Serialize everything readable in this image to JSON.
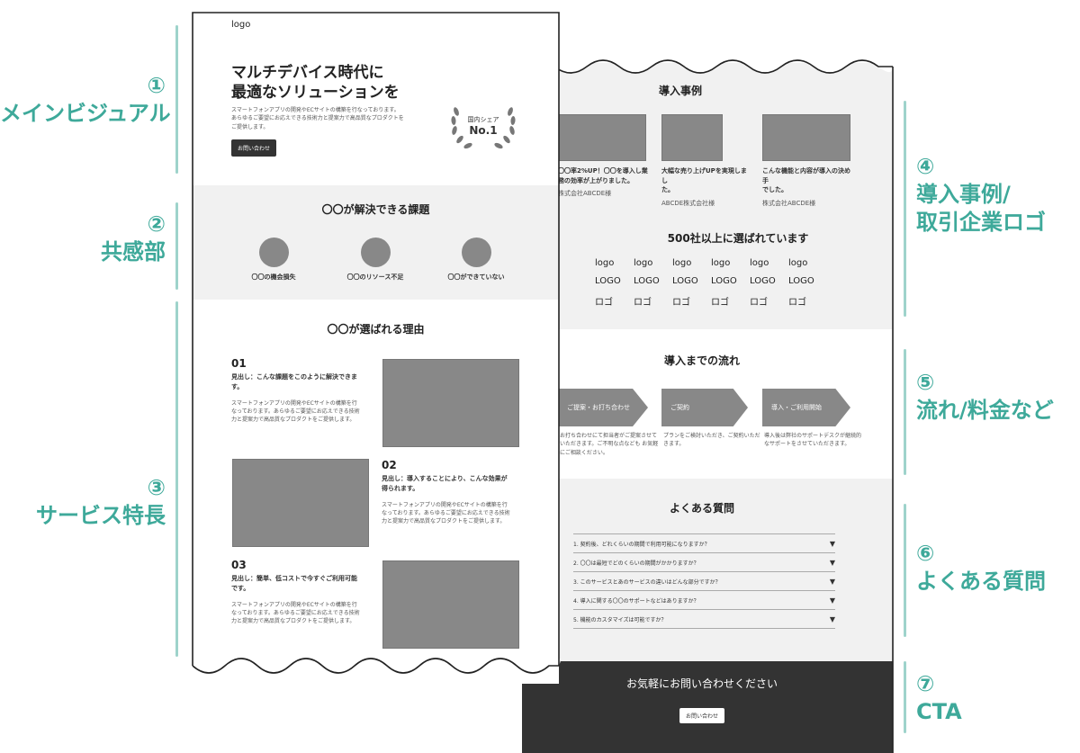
{
  "annotations": [
    {
      "num": "①",
      "lines": [
        "メインビジュアル"
      ]
    },
    {
      "num": "②",
      "lines": [
        "共感部"
      ]
    },
    {
      "num": "③",
      "lines": [
        "サービス特長"
      ]
    },
    {
      "num": "④",
      "lines": [
        "導入事例/",
        "取引企業ロゴ"
      ]
    },
    {
      "num": "⑤",
      "lines": [
        "流れ/料金など"
      ]
    },
    {
      "num": "⑥",
      "lines": [
        "よくある質問"
      ]
    },
    {
      "num": "⑦",
      "lines": [
        "CTA"
      ]
    }
  ],
  "hero": {
    "logo": "logo",
    "headline_1": "マルチデバイス時代に",
    "headline_2": "最適なソリューションを",
    "desc_1": "スマートフォンアプリの開発やECサイトの構築を行なっております。",
    "desc_2": "あらゆるご要望にお応えできる技術力と提案力で高品質なプロダクトを",
    "desc_3": "ご提供します。",
    "button": "お問い合わせ",
    "badge_top": "国内シェア",
    "badge_main": "No.1"
  },
  "empathy": {
    "title": "〇〇が解決できる課題",
    "items": [
      "〇〇の機会損失",
      "〇〇のリソース不足",
      "〇〇ができていない"
    ]
  },
  "features": {
    "title": "〇〇が選ばれる理由",
    "items": [
      {
        "num": "01",
        "heading_1": "見出し：こんな課題をこのように解決できま",
        "heading_2": "す。",
        "body_1": "スマートフォンアプリの開発やECサイトの構築を行",
        "body_2": "なっております。あらゆるご要望にお応えできる技術",
        "body_3": "力と提案力で高品質なプロダクトをご提供します。"
      },
      {
        "num": "02",
        "heading_1": "見出し：導入することにより、こんな効果が",
        "heading_2": "得られます。",
        "body_1": "スマートフォンアプリの開発やECサイトの構築を行",
        "body_2": "なっております。あらゆるご要望にお応えできる技術",
        "body_3": "力と提案力で高品質なプロダクトをご提供します。"
      },
      {
        "num": "03",
        "heading_1": "見出し：簡単、低コストで今すぐご利用可能",
        "heading_2": "です。",
        "body_1": "スマートフォンアプリの開発やECサイトの構築を行",
        "body_2": "なっております。あらゆるご要望にお応えできる技術",
        "body_3": "力と提案力で高品質なプロダクトをご提供します。"
      }
    ]
  },
  "cases": {
    "title": "導入事例",
    "items": [
      {
        "line_1": "〇〇率2%UP！〇〇を導入し業",
        "line_2": "務の効率が上がりました。",
        "company": "株式会社ABCDE様"
      },
      {
        "line_1": "大幅な売り上げUPを実現しまし",
        "line_2": "た。",
        "company": "ABCDE株式会社様"
      },
      {
        "line_1": "こんな機能と内容が導入の決め手",
        "line_2": "でした。",
        "company": "株式会社ABCDE様"
      }
    ]
  },
  "logos": {
    "title": "500社以上に選ばれています",
    "rows": [
      [
        "logo",
        "logo",
        "logo",
        "logo",
        "logo",
        "logo"
      ],
      [
        "LOGO",
        "LOGO",
        "LOGO",
        "LOGO",
        "LOGO",
        "LOGO"
      ],
      [
        "ロゴ",
        "ロゴ",
        "ロゴ",
        "ロゴ",
        "ロゴ",
        "ロゴ"
      ]
    ]
  },
  "flow": {
    "title": "導入までの流れ",
    "steps": [
      {
        "label": "ご提案・お打ち合わせ",
        "desc_1": "お打ち合わせにて担当者がご提案させて",
        "desc_2": "いただきます。ご不明な点なども お気軽",
        "desc_3": "にご相談ください。"
      },
      {
        "label": "ご契約",
        "desc_1": "プランをご検討いただき、ご契約いただ",
        "desc_2": "きます。",
        "desc_3": ""
      },
      {
        "label": "導入・ご利用開始",
        "desc_1": "導入後は弊社のサポートデスクが継続的",
        "desc_2": "なサポートをさせていただきます。",
        "desc_3": ""
      }
    ]
  },
  "faq": {
    "title": "よくある質問",
    "items": [
      "1. 契約後、どれくらいの期間で利用可能になりますか？",
      "2. 〇〇は最短でどのくらいの期間がかかりますか？",
      "3. このサービスとあのサービスの違いはどんな部分ですか？",
      "4. 導入に関する〇〇のサポートなどはありますか？",
      "5. 機能のカスタマイズは可能ですか？"
    ],
    "marker": "▼"
  },
  "cta": {
    "title": "お気軽にお問い合わせください",
    "button": "お問い合わせ"
  },
  "colors": {
    "accent": "#3ea99a",
    "accent_light": "#9ed3cb",
    "placeholder": "#888888",
    "grey_section": "#f1f1f1",
    "dark_section": "#333333"
  }
}
